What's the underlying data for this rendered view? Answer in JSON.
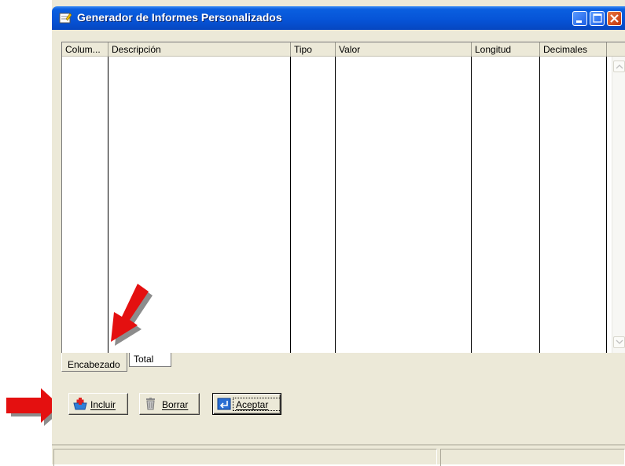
{
  "window": {
    "title": "Generador de Informes Personalizados",
    "title_icon": "report-editor-icon",
    "controls": [
      "minimize-icon",
      "maximize-icon",
      "close-icon"
    ]
  },
  "grid": {
    "columns": [
      "Colum...",
      "Descripción",
      "Tipo",
      "Valor",
      "Longitud",
      "Decimales"
    ],
    "rows": []
  },
  "tabs": [
    {
      "label": "Encabezado",
      "active": true
    },
    {
      "label": "Total",
      "active": false
    }
  ],
  "buttons": {
    "incluir": {
      "label": "Incluir",
      "icon": "add-record-icon"
    },
    "borrar": {
      "label": "Borrar",
      "icon": "trash-icon"
    },
    "aceptar": {
      "label": "Aceptar",
      "icon": "enter-icon",
      "default": true
    }
  },
  "annotations": {
    "arrow_color": "#e41010",
    "arrows": [
      "arrow-pointing-to-encabezado-tab",
      "arrow-pointing-to-incluir-button"
    ]
  },
  "colors": {
    "titlebar": "#0653d6",
    "face": "#ece9d8",
    "grid_background": "#ffffff"
  }
}
